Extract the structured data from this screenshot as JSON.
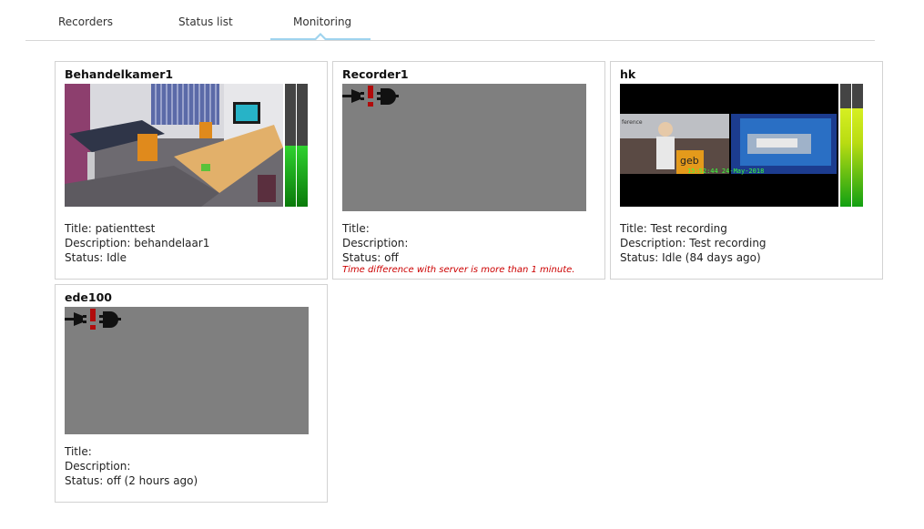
{
  "tabs": [
    {
      "label": "Recorders"
    },
    {
      "label": "Status list"
    },
    {
      "label": "Monitoring"
    }
  ],
  "active_tab": "Monitoring",
  "recorders": [
    {
      "name": "Behandelkamer1",
      "title_line": "Title: patienttest",
      "description_line": "Description: behandelaar1",
      "status_line": "Status: Idle",
      "feed": "live-room",
      "vu_levels": [
        0.5,
        0.5
      ]
    },
    {
      "name": "Recorder1",
      "title_line": "Title:",
      "description_line": "Description:",
      "status_line": "Status: off",
      "warning": "Time difference with server is more than 1 minute.",
      "feed": "disconnected",
      "icon": "unplugged-icon"
    },
    {
      "name": "hk",
      "title_line": "Title: Test recording",
      "description_line": "Description: Test recording",
      "status_line": "Status: Idle (84 days ago)",
      "feed": "live-conference",
      "overlay_timestamp": "15:52:44 24-May-2018",
      "vu_levels": [
        0.8,
        0.8
      ]
    },
    {
      "name": "ede100",
      "title_line": "Title:",
      "description_line": "Description:",
      "status_line": "Status: off (2 hours ago)",
      "feed": "disconnected",
      "icon": "unplugged-icon"
    }
  ]
}
